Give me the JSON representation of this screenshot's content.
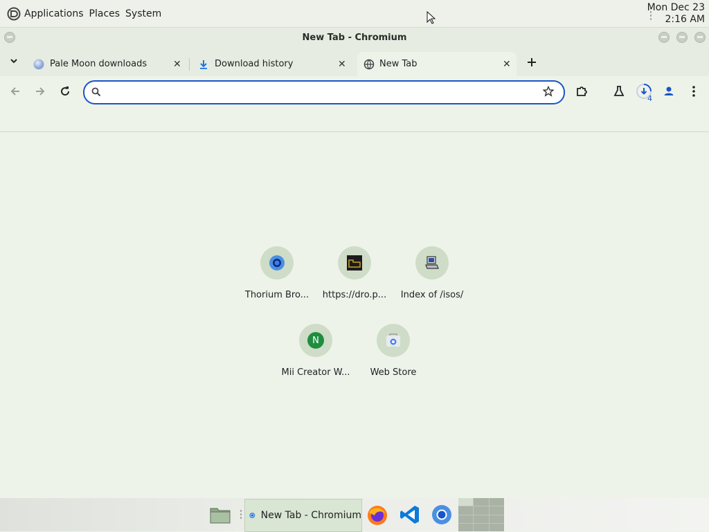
{
  "top_panel": {
    "menu": [
      "Applications",
      "Places",
      "System"
    ],
    "clock_date": "Mon Dec 23",
    "clock_time": "2:16 AM"
  },
  "window": {
    "title": "New Tab - Chromium"
  },
  "tabs": [
    {
      "label": "Pale Moon downloads",
      "icon": "pale-moon-icon"
    },
    {
      "label": "Download history",
      "icon": "download-icon"
    },
    {
      "label": "New Tab",
      "icon": "globe-icon",
      "active": true
    }
  ],
  "toolbar": {
    "address_value": "",
    "download_count": "4"
  },
  "shortcuts": [
    {
      "label": "Thorium Bro...",
      "icon": "thorium-icon"
    },
    {
      "label": "https://dro.p...",
      "icon": "site-icon"
    },
    {
      "label": "Index of /isos/",
      "icon": "computer-icon"
    },
    {
      "label": "Mii Creator W...",
      "icon": "letter-n-icon",
      "letter": "N"
    },
    {
      "label": "Web Store",
      "icon": "web-store-icon"
    }
  ],
  "taskbar": {
    "active_task": "New Tab - Chromium"
  },
  "colors": {
    "accent": "#1a55c8",
    "background": "#eef3ea",
    "tile_circle": "#cfdcc8"
  }
}
